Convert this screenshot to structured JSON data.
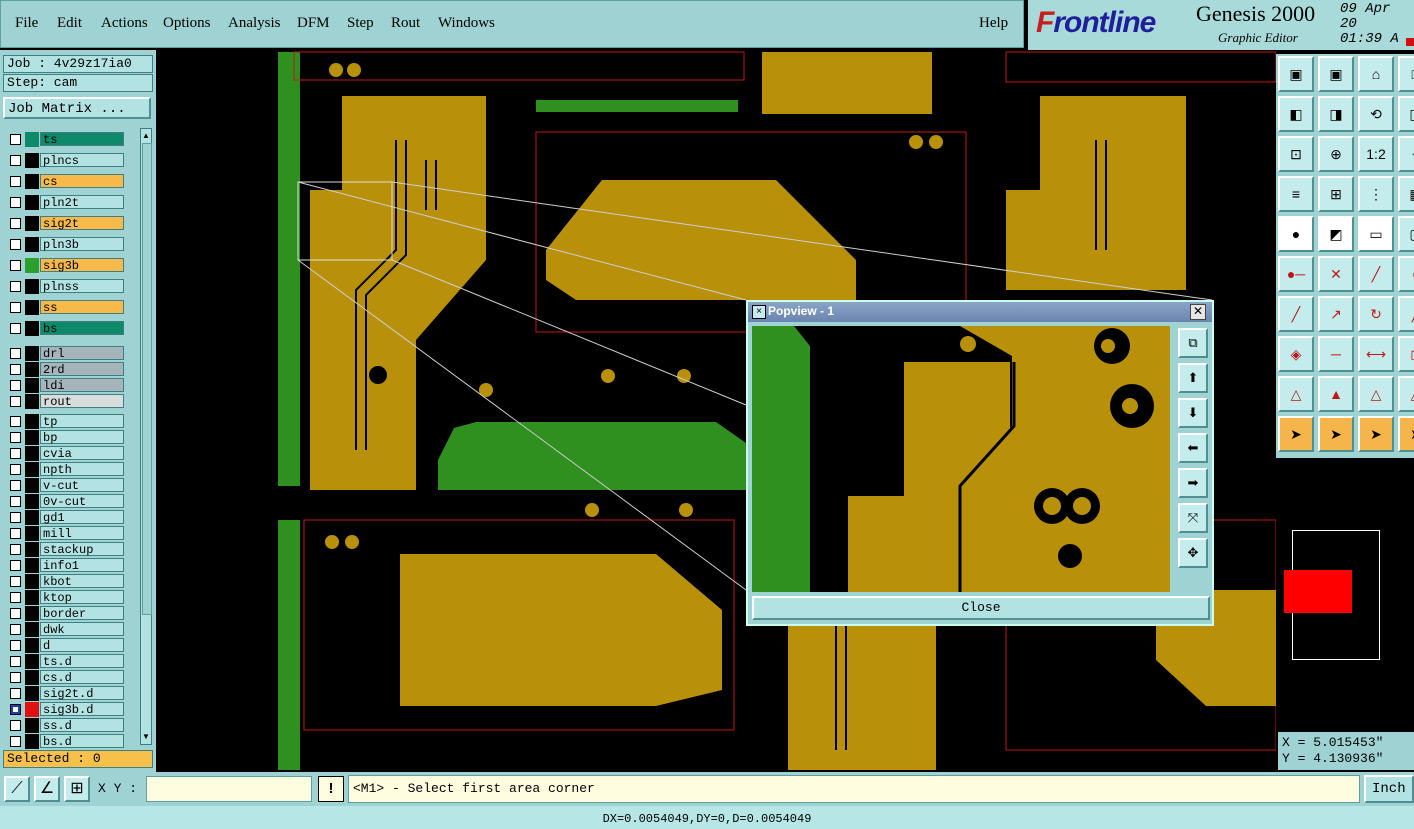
{
  "menu": {
    "items": [
      "File",
      "Edit",
      "Actions",
      "Options",
      "Analysis",
      "DFM",
      "Step",
      "Rout",
      "Windows"
    ],
    "help": "Help"
  },
  "brand": {
    "logo_rest": "rontline",
    "logo_first": "F",
    "product": "Genesis 2000",
    "subtitle": "Graphic Editor",
    "date_line1": "09 Apr 20",
    "date_line2": "01:39 A"
  },
  "job": {
    "job_label": "Job : 4v29z17ia0",
    "step_label": "Step: cam",
    "job_matrix_button": "Job Matrix ..."
  },
  "layers": [
    {
      "name": "ts",
      "color": "#0e8a6a",
      "swatch": "#0e8a6a"
    },
    {
      "name": "plncs",
      "color": "#b2e2e2",
      "swatch": "#000000"
    },
    {
      "name": "cs",
      "color": "#f7b94a",
      "swatch": "#000000"
    },
    {
      "name": "pln2t",
      "color": "#b2e2e2",
      "swatch": "#000000"
    },
    {
      "name": "sig2t",
      "color": "#f7b94a",
      "swatch": "#000000"
    },
    {
      "name": "pln3b",
      "color": "#b2e2e2",
      "swatch": "#000000"
    },
    {
      "name": "sig3b",
      "color": "#f7b94a",
      "swatch": "#2ca02c"
    },
    {
      "name": "plnss",
      "color": "#b2e2e2",
      "swatch": "#000000"
    },
    {
      "name": "ss",
      "color": "#f7b94a",
      "swatch": "#000000"
    },
    {
      "name": "bs",
      "color": "#0e8a6a",
      "swatch": "#000000"
    },
    {
      "name": "drl",
      "color": "#a6b4bc",
      "swatch": "#000000"
    },
    {
      "name": "2rd",
      "color": "#a6b4bc",
      "swatch": "#000000"
    },
    {
      "name": "ldi",
      "color": "#a6b4bc",
      "swatch": "#000000"
    },
    {
      "name": "rout",
      "color": "#d8dcdc",
      "swatch": "#000000"
    },
    {
      "name": "tp",
      "color": "#b2e2e2",
      "swatch": "#000000"
    },
    {
      "name": "bp",
      "color": "#b2e2e2",
      "swatch": "#000000"
    },
    {
      "name": "cvia",
      "color": "#b2e2e2",
      "swatch": "#000000"
    },
    {
      "name": "npth",
      "color": "#b2e2e2",
      "swatch": "#000000"
    },
    {
      "name": "v-cut",
      "color": "#b2e2e2",
      "swatch": "#000000"
    },
    {
      "name": "0v-cut",
      "color": "#b2e2e2",
      "swatch": "#000000"
    },
    {
      "name": "gd1",
      "color": "#b2e2e2",
      "swatch": "#000000"
    },
    {
      "name": "mill",
      "color": "#b2e2e2",
      "swatch": "#000000"
    },
    {
      "name": "stackup",
      "color": "#b2e2e2",
      "swatch": "#000000"
    },
    {
      "name": "info1",
      "color": "#b2e2e2",
      "swatch": "#000000"
    },
    {
      "name": "kbot",
      "color": "#b2e2e2",
      "swatch": "#000000"
    },
    {
      "name": "ktop",
      "color": "#b2e2e2",
      "swatch": "#000000"
    },
    {
      "name": "border",
      "color": "#b2e2e2",
      "swatch": "#000000"
    },
    {
      "name": "dwk",
      "color": "#b2e2e2",
      "swatch": "#000000"
    },
    {
      "name": "d",
      "color": "#b2e2e2",
      "swatch": "#000000"
    },
    {
      "name": "ts.d",
      "color": "#b2e2e2",
      "swatch": "#000000"
    },
    {
      "name": "cs.d",
      "color": "#b2e2e2",
      "swatch": "#000000"
    },
    {
      "name": "sig2t.d",
      "color": "#b2e2e2",
      "swatch": "#000000"
    },
    {
      "name": "sig3b.d",
      "color": "#b2e2e2",
      "swatch": "#e01010"
    },
    {
      "name": "ss.d",
      "color": "#b2e2e2",
      "swatch": "#000000"
    },
    {
      "name": "bs.d",
      "color": "#b2e2e2",
      "swatch": "#000000"
    }
  ],
  "selected_label": "Selected : 0",
  "popview": {
    "title": "Popview - 1",
    "close_label": "Close"
  },
  "coords": {
    "x": "X = 5.015453\"",
    "y": "Y = 4.130936\""
  },
  "status": {
    "xy_label": "X Y :",
    "xy_value": "",
    "prompt": "<M1> - Select first area corner",
    "units_button": "Inch",
    "measure": "DX=0.0054049,DY=0,D=0.0054049"
  },
  "colors": {
    "copper": "#b8900a",
    "green_layer": "#2f8f1f",
    "outline": "#c01818",
    "panel": "#9fd3d3"
  },
  "icons": {
    "toolbar_rows": 10
  }
}
